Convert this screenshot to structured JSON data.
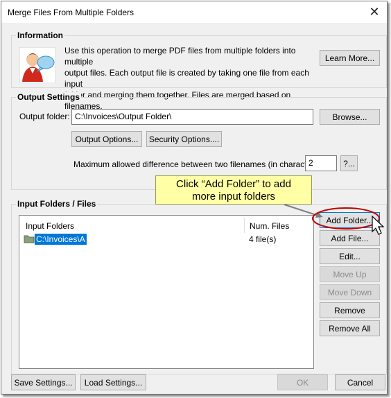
{
  "window": {
    "title": "Merge Files From Multiple Folders"
  },
  "information": {
    "heading": "Information",
    "line1": "Use this operation to merge PDF files from multiple folders into multiple",
    "line2": "output files. Each output file is created by taking one file from each input",
    "line3": "folder and merging them together. Files are merged based on filenames.",
    "learn_more": "Learn More..."
  },
  "output": {
    "heading": "Output Settings",
    "folder_label": "Output folder:",
    "folder_value": "C:\\Invoices\\Output Folder\\",
    "browse": "Browse...",
    "output_options": "Output Options...",
    "security_options": "Security Options....",
    "max_diff_label": "Maximum allowed difference between two filenames (in characters):",
    "max_diff_value": "2",
    "help_button": "?..."
  },
  "input": {
    "heading": "Input Folders / Files",
    "columns": [
      "Input Folders",
      "Num. Files"
    ],
    "rows": [
      {
        "folder": "C:\\Invoices\\A",
        "files": "4 file(s)"
      }
    ],
    "buttons": {
      "add_folder": "Add Folder...",
      "add_file": "Add File...",
      "edit": "Edit...",
      "move_up": "Move Up",
      "move_down": "Move Down",
      "remove": "Remove",
      "remove_all": "Remove All"
    }
  },
  "callout": {
    "line1": "Click “Add Folder” to add",
    "line2": "more input folders"
  },
  "footer": {
    "save_settings": "Save Settings...",
    "load_settings": "Load Settings...",
    "ok": "OK",
    "cancel": "Cancel"
  },
  "colors": {
    "selection": "#0078d7",
    "callout_fill": "#ffffa5",
    "highlight_ring": "#c00000",
    "arrow": "#7f7f7f"
  }
}
